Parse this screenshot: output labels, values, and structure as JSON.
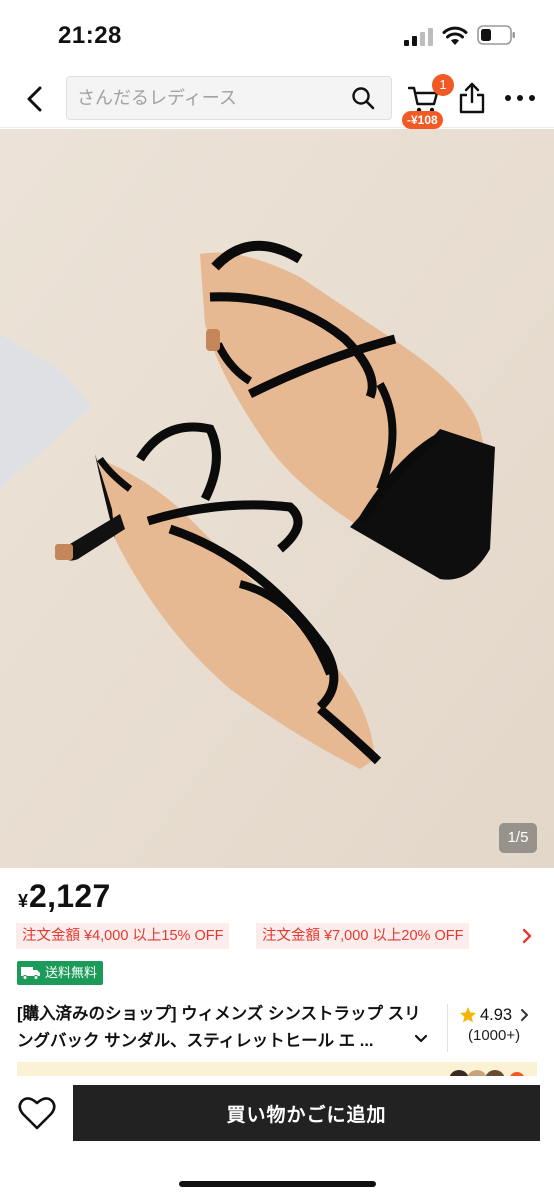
{
  "status_bar": {
    "time": "21:28"
  },
  "header": {
    "search_placeholder": "さんだるレディース",
    "cart_badge": "1",
    "cart_discount": "-¥108"
  },
  "gallery": {
    "counter": "1/5"
  },
  "product": {
    "currency": "¥",
    "price": "2,127",
    "coupons": [
      "注文金額 ¥4,000 以上15% OFF",
      "注文金額 ¥7,000 以上20% OFF"
    ],
    "shipping_badge": "送料無料",
    "title": "[購入済みのショップ] ウィメンズ シンストラップ スリングバック サンダル、スティレットヒール エ ...",
    "rating": "4.93",
    "review_count": "(1000+)"
  },
  "bottom_bar": {
    "add_to_cart": "買い物かごに追加"
  },
  "colors": {
    "accent": "#f15a24",
    "coupon_text": "#e33a2f",
    "coupon_bg": "#fdecec",
    "shipping_green": "#1c9a5a",
    "cta_bg": "#222222",
    "star": "#f5b400"
  },
  "icons": [
    "back-chevron-icon",
    "search-icon",
    "cart-icon",
    "share-icon",
    "more-icon",
    "chevron-right-icon",
    "truck-icon",
    "chevron-down-icon",
    "star-icon",
    "heart-icon"
  ]
}
